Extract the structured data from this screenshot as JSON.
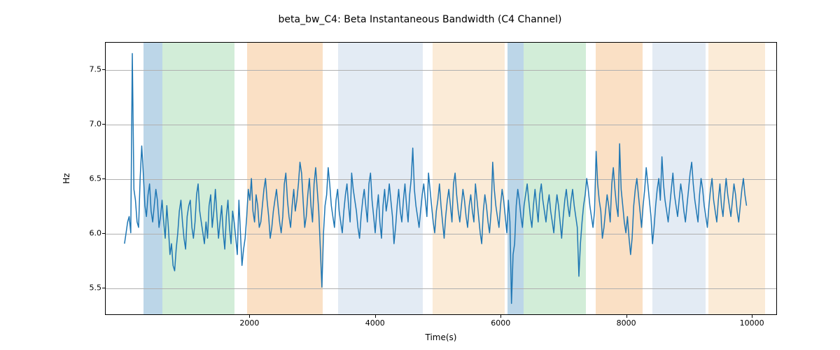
{
  "chart_data": {
    "type": "line",
    "title": "beta_bw_C4: Beta Instantaneous Bandwidth (C4 Channel)",
    "xlabel": "Time(s)",
    "ylabel": "Hz",
    "xlim": [
      -300,
      10400
    ],
    "ylim": [
      5.25,
      7.75
    ],
    "x_ticks": [
      2000,
      4000,
      6000,
      8000,
      10000
    ],
    "y_ticks": [
      5.5,
      6.0,
      6.5,
      7.0,
      7.5
    ],
    "bands": [
      {
        "x0": 300,
        "x1": 600,
        "color": "#6aa5cd",
        "alpha": 0.45
      },
      {
        "x0": 600,
        "x1": 1750,
        "color": "#8fd19e",
        "alpha": 0.4
      },
      {
        "x0": 1950,
        "x1": 3150,
        "color": "#f3b26f",
        "alpha": 0.4
      },
      {
        "x0": 3400,
        "x1": 4750,
        "color": "#b9cde3",
        "alpha": 0.4
      },
      {
        "x0": 4900,
        "x1": 6050,
        "color": "#f7d7b0",
        "alpha": 0.5
      },
      {
        "x0": 6100,
        "x1": 6350,
        "color": "#6aa5cd",
        "alpha": 0.45
      },
      {
        "x0": 6350,
        "x1": 7350,
        "color": "#8fd19e",
        "alpha": 0.4
      },
      {
        "x0": 7500,
        "x1": 8250,
        "color": "#f3b26f",
        "alpha": 0.4
      },
      {
        "x0": 8400,
        "x1": 9250,
        "color": "#b9cde3",
        "alpha": 0.4
      },
      {
        "x0": 9300,
        "x1": 10200,
        "color": "#f7d7b0",
        "alpha": 0.5
      }
    ],
    "series": [
      {
        "name": "beta_bw_C4",
        "x_start": 0,
        "x_step": 25,
        "values": [
          5.9,
          6.0,
          6.1,
          6.15,
          6.0,
          7.65,
          6.4,
          6.3,
          6.1,
          6.05,
          6.5,
          6.8,
          6.55,
          6.25,
          6.15,
          6.35,
          6.45,
          6.2,
          6.1,
          6.25,
          6.4,
          6.3,
          6.05,
          6.15,
          6.3,
          6.1,
          5.95,
          6.25,
          6.05,
          5.8,
          5.9,
          5.7,
          5.65,
          5.85,
          6.0,
          6.2,
          6.3,
          6.1,
          5.95,
          5.85,
          6.15,
          6.25,
          6.3,
          6.05,
          5.95,
          6.1,
          6.35,
          6.45,
          6.2,
          6.1,
          6.0,
          5.9,
          6.1,
          5.95,
          6.25,
          6.35,
          6.05,
          6.2,
          6.4,
          6.15,
          5.95,
          6.1,
          6.25,
          6.0,
          5.85,
          6.15,
          6.3,
          6.05,
          5.9,
          6.2,
          6.1,
          5.95,
          5.8,
          6.3,
          6.0,
          5.7,
          5.85,
          5.95,
          6.15,
          6.4,
          6.3,
          6.5,
          6.2,
          6.1,
          6.35,
          6.25,
          6.05,
          6.1,
          6.25,
          6.4,
          6.5,
          6.3,
          6.15,
          5.95,
          6.05,
          6.2,
          6.3,
          6.4,
          6.25,
          6.1,
          6.0,
          6.15,
          6.45,
          6.55,
          6.3,
          6.15,
          6.05,
          6.25,
          6.4,
          6.2,
          6.3,
          6.45,
          6.65,
          6.55,
          6.3,
          6.05,
          6.15,
          6.35,
          6.5,
          6.25,
          6.1,
          6.45,
          6.6,
          6.4,
          6.2,
          5.85,
          5.5,
          6.0,
          6.25,
          6.35,
          6.6,
          6.45,
          6.25,
          6.15,
          6.05,
          6.3,
          6.4,
          6.2,
          6.1,
          6.0,
          6.2,
          6.35,
          6.45,
          6.25,
          6.1,
          6.55,
          6.4,
          6.3,
          6.2,
          6.05,
          5.95,
          6.15,
          6.3,
          6.4,
          6.25,
          6.1,
          6.45,
          6.55,
          6.3,
          6.15,
          6.0,
          6.2,
          6.35,
          6.1,
          5.95,
          6.25,
          6.4,
          6.2,
          6.3,
          6.45,
          6.3,
          6.15,
          5.9,
          6.05,
          6.25,
          6.4,
          6.2,
          6.1,
          6.3,
          6.45,
          6.25,
          6.1,
          6.35,
          6.5,
          6.78,
          6.4,
          6.25,
          6.15,
          6.05,
          6.2,
          6.35,
          6.45,
          6.3,
          6.15,
          6.55,
          6.4,
          6.25,
          6.1,
          6.0,
          6.2,
          6.3,
          6.45,
          6.25,
          6.1,
          5.95,
          6.15,
          6.3,
          6.4,
          6.25,
          6.1,
          6.45,
          6.55,
          6.35,
          6.2,
          6.1,
          6.25,
          6.4,
          6.3,
          6.15,
          6.05,
          6.25,
          6.35,
          6.2,
          6.1,
          6.45,
          6.3,
          6.15,
          6.0,
          5.9,
          6.2,
          6.35,
          6.25,
          6.1,
          6.0,
          6.2,
          6.65,
          6.4,
          6.25,
          6.15,
          6.05,
          6.25,
          6.4,
          6.3,
          6.15,
          6.0,
          6.3,
          6.1,
          5.35,
          5.8,
          5.9,
          6.25,
          6.4,
          6.3,
          6.15,
          6.05,
          6.25,
          6.35,
          6.45,
          6.3,
          6.15,
          6.05,
          6.25,
          6.4,
          6.25,
          6.1,
          6.35,
          6.45,
          6.3,
          6.2,
          6.1,
          6.25,
          6.35,
          6.2,
          6.1,
          6.0,
          6.2,
          6.35,
          6.25,
          6.1,
          5.95,
          6.15,
          6.3,
          6.4,
          6.25,
          6.15,
          6.3,
          6.4,
          6.25,
          6.15,
          6.05,
          5.6,
          5.9,
          6.1,
          6.25,
          6.35,
          6.5,
          6.4,
          6.25,
          6.15,
          6.05,
          6.2,
          6.75,
          6.45,
          6.3,
          6.2,
          5.95,
          6.05,
          6.2,
          6.35,
          6.25,
          6.1,
          6.45,
          6.6,
          6.4,
          6.25,
          6.15,
          6.82,
          6.4,
          6.25,
          6.1,
          6.0,
          6.15,
          5.95,
          5.8,
          5.95,
          6.25,
          6.4,
          6.5,
          6.35,
          6.2,
          6.05,
          6.25,
          6.4,
          6.6,
          6.45,
          6.3,
          6.15,
          5.9,
          6.05,
          6.25,
          6.4,
          6.5,
          6.3,
          6.7,
          6.45,
          6.3,
          6.2,
          6.1,
          6.25,
          6.4,
          6.55,
          6.35,
          6.25,
          6.15,
          6.3,
          6.45,
          6.35,
          6.2,
          6.1,
          6.25,
          6.4,
          6.55,
          6.65,
          6.45,
          6.3,
          6.2,
          6.1,
          6.35,
          6.5,
          6.4,
          6.25,
          6.15,
          6.05,
          6.25,
          6.4,
          6.5,
          6.3,
          6.2,
          6.1,
          6.3,
          6.45,
          6.25,
          6.15,
          6.35,
          6.5,
          6.35,
          6.25,
          6.15,
          6.3,
          6.45,
          6.35,
          6.2,
          6.1,
          6.25,
          6.4,
          6.5,
          6.35,
          6.25
        ]
      }
    ]
  }
}
